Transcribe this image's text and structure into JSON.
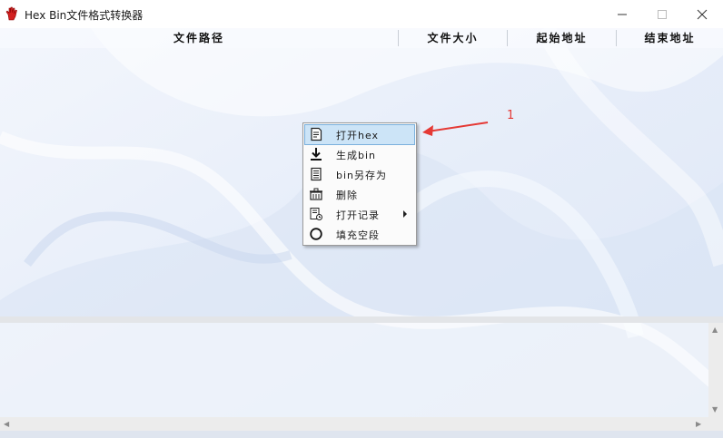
{
  "window": {
    "title": "Hex Bin文件格式转换器",
    "app_icon": "red-hand-icon"
  },
  "table": {
    "headers": [
      "文件路径",
      "文件大小",
      "起始地址",
      "结束地址"
    ]
  },
  "context_menu": {
    "items": [
      {
        "label": "打开hex",
        "icon": "open-file-icon",
        "selected": true,
        "has_submenu": false
      },
      {
        "label": "生成bin",
        "icon": "download-icon",
        "selected": false,
        "has_submenu": false
      },
      {
        "label": "bin另存为",
        "icon": "save-as-icon",
        "selected": false,
        "has_submenu": false
      },
      {
        "label": "删除",
        "icon": "delete-icon",
        "selected": false,
        "has_submenu": false
      },
      {
        "label": "打开记录",
        "icon": "history-icon",
        "selected": false,
        "has_submenu": true
      },
      {
        "label": "填充空段",
        "icon": "circle-icon",
        "selected": false,
        "has_submenu": false
      }
    ]
  },
  "annotation": {
    "label": "1",
    "color": "#e53935"
  },
  "colors": {
    "menu_highlight": "#cce4f7",
    "menu_highlight_border": "#7ab0dd"
  }
}
